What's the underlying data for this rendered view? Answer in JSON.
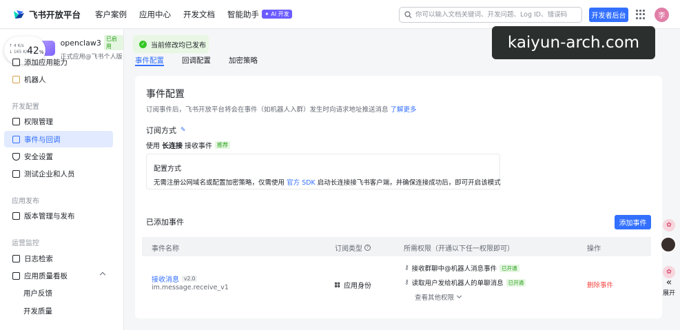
{
  "brand": {
    "name": "飞书开放平台"
  },
  "nav": {
    "links": [
      "客户案例",
      "应用中心",
      "开发文档",
      "智能助手"
    ],
    "ai_badge": "✦ AI 开发",
    "search_placeholder": "你可以输入文档关键词、开发问题、Log ID、错误码",
    "dev_console": "开发者后台",
    "avatar": "李"
  },
  "speed": {
    "up": "↑ 4  K/s",
    "down": "↓ 165 K/s",
    "value": "42",
    "unit": "%"
  },
  "app": {
    "name": "openclaw3",
    "status": "已启用",
    "subtitle": "正式应用@飞书个人版"
  },
  "toast": {
    "text": "当前修改均已发布"
  },
  "watermark": "kaiyun-arch.com",
  "sidebar": {
    "items_top": [
      {
        "label": "添加应用能力"
      },
      {
        "label": "机器人"
      }
    ],
    "group_dev": "开发配置",
    "items_dev": [
      {
        "label": "权限管理"
      },
      {
        "label": "事件与回调"
      },
      {
        "label": "安全设置"
      },
      {
        "label": "测试企业和人员"
      }
    ],
    "group_release": "应用发布",
    "items_release": [
      {
        "label": "版本管理与发布"
      }
    ],
    "group_ops": "运营监控",
    "items_ops": [
      {
        "label": "日志检索"
      },
      {
        "label": "应用质量看板"
      }
    ],
    "items_sub": [
      {
        "label": "用户反馈"
      },
      {
        "label": "开发质量"
      }
    ]
  },
  "tabs": [
    "事件配置",
    "回调配置",
    "加密策略"
  ],
  "event_config": {
    "title": "事件配置",
    "desc": "订阅事件后，飞书开放平台将会在事件（如机器人入群）发生时向请求地址推送消息",
    "learn_more": "了解更多",
    "subscribe_title": "订阅方式",
    "use_prefix": "使用",
    "use_mode": "长连接",
    "use_suffix": "接收事件",
    "recommend": "推荐",
    "config_title": "配置方式",
    "config_text_1": "无需注册公网域名或配置加密策略，仅需使用",
    "config_link": "官方 SDK",
    "config_text_2": "启动长连接接飞书客户端，并确保连接成功后，即可开启该模式"
  },
  "added_events": {
    "title": "已添加事件",
    "add_button": "添加事件",
    "columns": [
      "事件名称",
      "订阅类型",
      "所需权限（开通以下任一权限即可）",
      "操作"
    ],
    "rows": [
      {
        "name": "接收消息",
        "version": "v2.0",
        "code": "im.message.receive_v1",
        "type": "应用身份",
        "permissions": [
          {
            "label": "接收群聊中@机器人消息事件",
            "status": "已开通"
          },
          {
            "label": "读取用户发给机器人的单聊消息",
            "status": "已开通"
          }
        ],
        "more": "查看其他权限",
        "action": "删除事件"
      }
    ]
  },
  "right_float": {
    "expand": "展开"
  }
}
